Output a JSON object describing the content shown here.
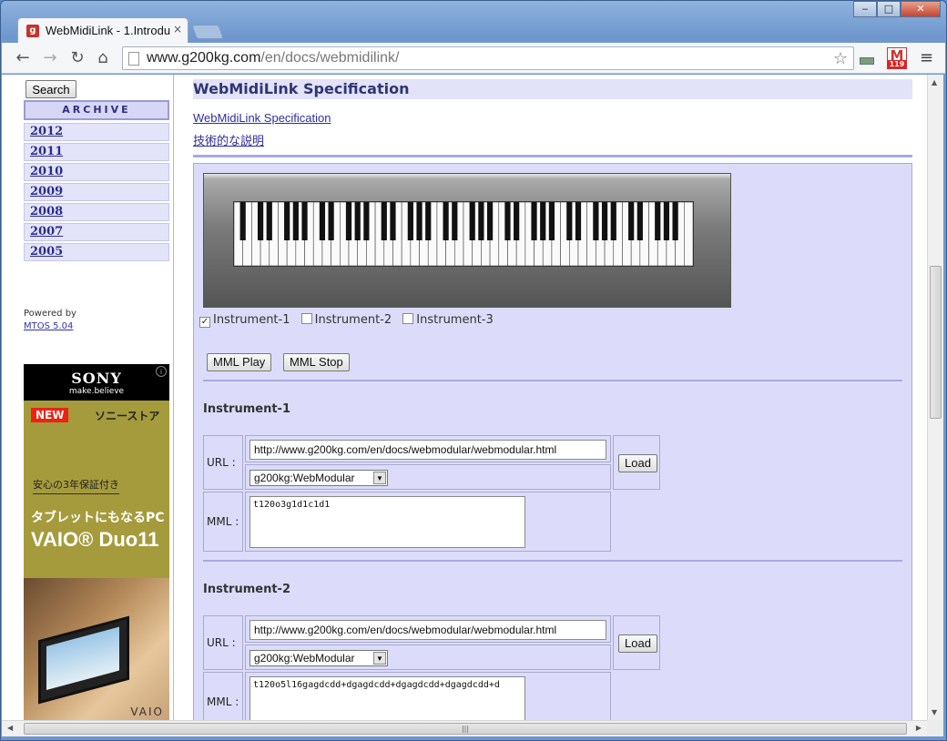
{
  "browser": {
    "tab_title": "WebMidiLink - 1.Introdu",
    "url_host": "www.g200kg.com",
    "url_path": "/en/docs/webmidilink/",
    "extension_badge": "119",
    "window_buttons": [
      "‒",
      "□",
      "✕"
    ]
  },
  "sidebar": {
    "search_label": "Search",
    "archive_title": "ARCHIVE",
    "years": [
      "2012",
      "2011",
      "2010",
      "2009",
      "2008",
      "2007",
      "2005"
    ],
    "powered_by": "Powered by",
    "powered_link": "MTOS 5.04"
  },
  "ad": {
    "brand": "SONY",
    "tagline": "make.believe",
    "badge": "NEW",
    "store": "ソニーストア",
    "warranty": "安心の3年保証付き",
    "headline": "タブレットにもなるPC",
    "product": "VAIO® Duo11",
    "logo": "VAIO"
  },
  "main": {
    "heading": "WebMidiLink Specification",
    "link1": "WebMidiLink Specification",
    "link2": "技術的な説明",
    "instruments_checkboxes": [
      {
        "label": "Instrument-1",
        "checked": true
      },
      {
        "label": "Instrument-2",
        "checked": false
      },
      {
        "label": "Instrument-3",
        "checked": false
      }
    ],
    "mml_play": "MML Play",
    "mml_stop": "MML Stop",
    "instruments": [
      {
        "title": "Instrument-1",
        "url_label": "URL :",
        "url_value": "http://www.g200kg.com/en/docs/webmodular/webmodular.html",
        "select_value": "g200kg:WebModular",
        "load_label": "Load",
        "mml_label": "MML :",
        "mml_value": "t120o3g1d1c1d1"
      },
      {
        "title": "Instrument-2",
        "url_label": "URL :",
        "url_value": "http://www.g200kg.com/en/docs/webmodular/webmodular.html",
        "select_value": "g200kg:WebModular",
        "load_label": "Load",
        "mml_label": "MML :",
        "mml_value": "t120o5l16gagdcdd+dgagdcdd+dgagdcdd+dgagdcdd+d"
      }
    ]
  }
}
